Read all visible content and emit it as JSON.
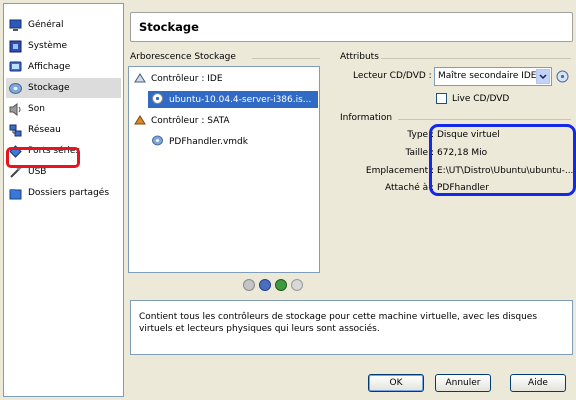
{
  "sidebar": {
    "items": [
      {
        "label": "Général",
        "icon": "general-monitor-icon"
      },
      {
        "label": "Système",
        "icon": "system-chip-icon"
      },
      {
        "label": "Affichage",
        "icon": "display-monitor-icon"
      },
      {
        "label": "Stockage",
        "icon": "storage-disk-icon"
      },
      {
        "label": "Son",
        "icon": "speaker-icon"
      },
      {
        "label": "Réseau",
        "icon": "network-icon"
      },
      {
        "label": "Ports séries",
        "icon": "serial-port-icon"
      },
      {
        "label": "USB",
        "icon": "usb-icon"
      },
      {
        "label": "Dossiers partagés",
        "icon": "shared-folder-icon"
      }
    ],
    "selected": "Stockage"
  },
  "header": {
    "title": "Stockage"
  },
  "tree": {
    "group_title": "Arborescence Stockage",
    "controller_ide": "Contrôleur : IDE",
    "ide_device": "ubuntu-10.04.4-server-i386.is...",
    "controller_sata": "Contrôleur : SATA",
    "sata_device": "PDFhandler.vmdk"
  },
  "attributes": {
    "group_title": "Attributs",
    "cd_label": "Lecteur CD/DVD :",
    "cd_value": "Maître secondaire IDE",
    "live_cd": "Live CD/DVD"
  },
  "information": {
    "group_title": "Information",
    "type_label": "Type :",
    "type_value": "Disque virtuel",
    "size_label": "Taille :",
    "size_value": "672,18 Mio",
    "location_label": "Emplacement :",
    "location_value": "E:\\UT\\Distro\\Ubuntu\\ubuntu-...",
    "attached_label": "Attaché à :",
    "attached_value": "PDFhandler"
  },
  "description": "Contient tous les contrôleurs de stockage pour cette machine virtuelle, avec les disques virtuels et lecteurs physiques qui leurs sont associés.",
  "buttons": {
    "ok": "OK",
    "cancel": "Annuler",
    "help": "Aide"
  },
  "colors": {
    "selection": "#316ac5",
    "highlight_red": "#e8141d",
    "highlight_blue": "#1229e6",
    "dialog_bg": "#ece9d8"
  }
}
